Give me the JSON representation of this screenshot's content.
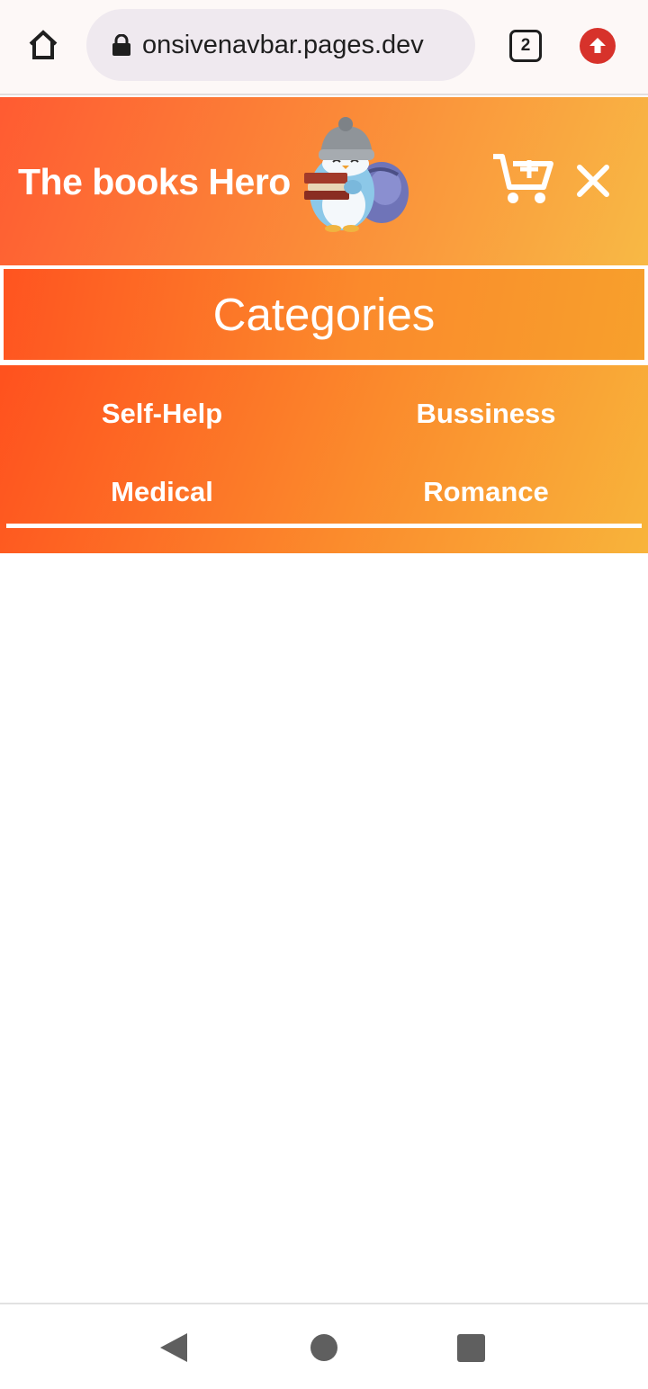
{
  "browser": {
    "url": "onsivenavbar.pages.dev",
    "tab_count": "2",
    "icons": {
      "home": "home-icon",
      "lock": "lock-icon",
      "update": "upload-arrow-icon"
    }
  },
  "header": {
    "brand_title": "The books Hero",
    "mascot": "penguin-with-books-mascot",
    "cart_icon": "cart-plus-icon",
    "close_icon": "close-icon"
  },
  "categories": {
    "title": "Categories",
    "items": [
      {
        "label": "Self-Help"
      },
      {
        "label": "Bussiness"
      },
      {
        "label": "Medical"
      },
      {
        "label": "Romance"
      }
    ]
  },
  "colors": {
    "gradient_start": "#ff5b32",
    "gradient_end": "#f8b945",
    "update_button": "#d7322b"
  },
  "system_nav": {
    "back": "back-triangle-icon",
    "home": "home-circle-icon",
    "recents": "recents-square-icon"
  }
}
